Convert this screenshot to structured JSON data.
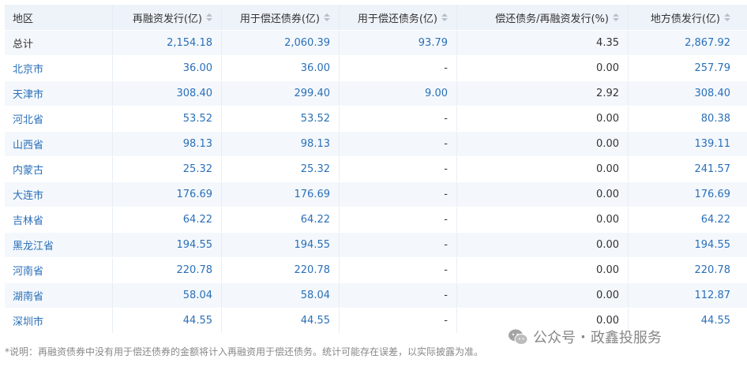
{
  "table": {
    "headers": [
      "地区",
      "再融资发行(亿)",
      "用于偿还债券(亿)",
      "用于偿还债务(亿)",
      "偿还债务/再融资发行(%)",
      "地方债发行(亿)"
    ],
    "rows": [
      {
        "region": "总计",
        "refinance": "2,154.18",
        "repay_bonds": "2,060.39",
        "repay_debt": "93.79",
        "ratio": "4.35",
        "local_debt": "2,867.92"
      },
      {
        "region": "北京市",
        "refinance": "36.00",
        "repay_bonds": "36.00",
        "repay_debt": "-",
        "ratio": "0.00",
        "local_debt": "257.79"
      },
      {
        "region": "天津市",
        "refinance": "308.40",
        "repay_bonds": "299.40",
        "repay_debt": "9.00",
        "ratio": "2.92",
        "local_debt": "308.40"
      },
      {
        "region": "河北省",
        "refinance": "53.52",
        "repay_bonds": "53.52",
        "repay_debt": "-",
        "ratio": "0.00",
        "local_debt": "80.38"
      },
      {
        "region": "山西省",
        "refinance": "98.13",
        "repay_bonds": "98.13",
        "repay_debt": "-",
        "ratio": "0.00",
        "local_debt": "139.11"
      },
      {
        "region": "内蒙古",
        "refinance": "25.32",
        "repay_bonds": "25.32",
        "repay_debt": "-",
        "ratio": "0.00",
        "local_debt": "241.57"
      },
      {
        "region": "大连市",
        "refinance": "176.69",
        "repay_bonds": "176.69",
        "repay_debt": "-",
        "ratio": "0.00",
        "local_debt": "176.69"
      },
      {
        "region": "吉林省",
        "refinance": "64.22",
        "repay_bonds": "64.22",
        "repay_debt": "-",
        "ratio": "0.00",
        "local_debt": "64.22"
      },
      {
        "region": "黑龙江省",
        "refinance": "194.55",
        "repay_bonds": "194.55",
        "repay_debt": "-",
        "ratio": "0.00",
        "local_debt": "194.55"
      },
      {
        "region": "河南省",
        "refinance": "220.78",
        "repay_bonds": "220.78",
        "repay_debt": "-",
        "ratio": "0.00",
        "local_debt": "220.78"
      },
      {
        "region": "湖南省",
        "refinance": "58.04",
        "repay_bonds": "58.04",
        "repay_debt": "-",
        "ratio": "0.00",
        "local_debt": "112.87"
      },
      {
        "region": "深圳市",
        "refinance": "44.55",
        "repay_bonds": "44.55",
        "repay_debt": "-",
        "ratio": "0.00",
        "local_debt": "44.55"
      }
    ]
  },
  "footnote": "*说明：再融资债券中没有用于偿还债券的金额将计入再融资用于偿还债务。统计可能存在误差，以实际披露为准。",
  "watermark": {
    "source": "公众号",
    "separator": "·",
    "account": "政鑫投服务"
  },
  "colors": {
    "link": "#2a6fb8",
    "header_bg": "#eef3f9",
    "stripe_bg": "#f4f8fc",
    "text": "#333333"
  }
}
